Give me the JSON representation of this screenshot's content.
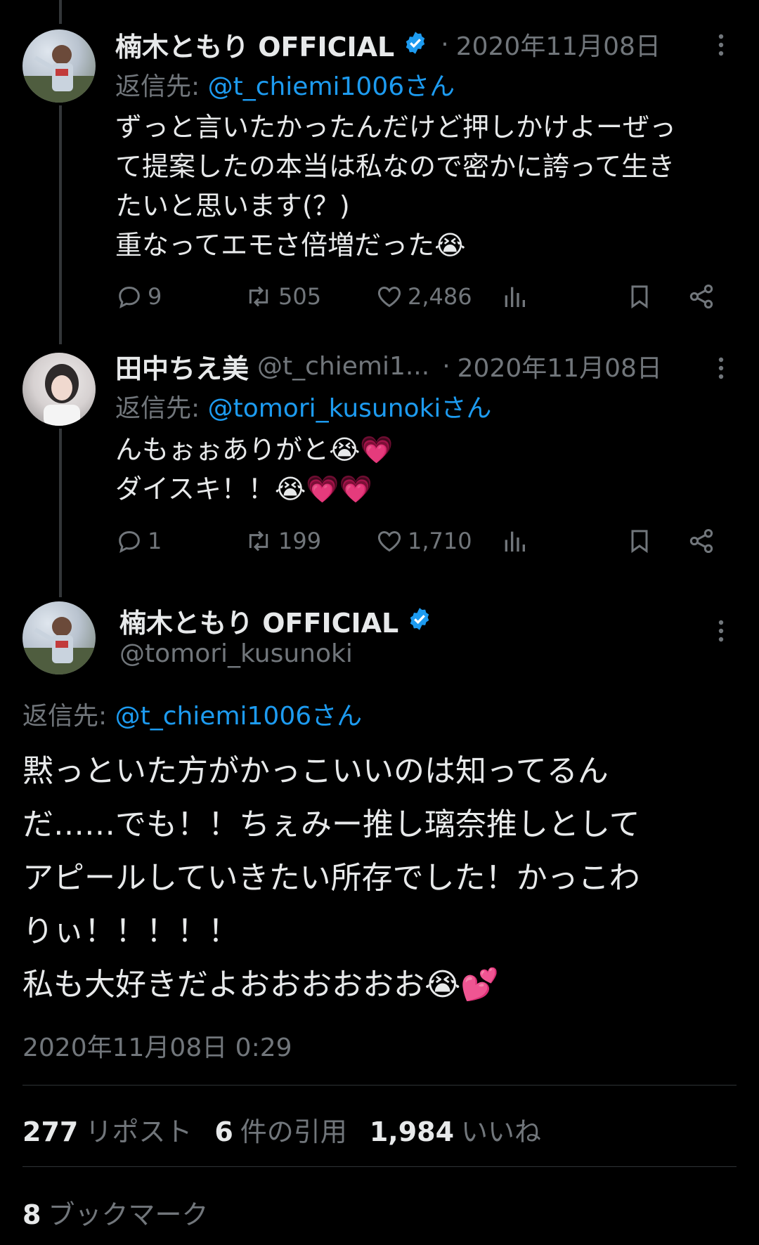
{
  "tweets": [
    {
      "display_name": "楠木ともり OFFICIAL",
      "verified": true,
      "timestamp": "2020年11月08日",
      "reply_prefix": "返信先: ",
      "reply_handle": "@t_chiemi1006さん",
      "text": "ずっと言いたかったんだけど押しかけよーぜっ\nて提案したの本当は私なので密かに誇って生き\nたいと思います(？)\n重なってエモさ倍増だった😭",
      "replies": "9",
      "reposts": "505",
      "likes": "2,486"
    },
    {
      "display_name": "田中ちえ美",
      "handle": "@t_chiemi1...",
      "timestamp": "2020年11月08日",
      "reply_prefix": "返信先: ",
      "reply_handle": "@tomori_kusunokiさん",
      "text": "んもぉぉありがと😭💗\nダイスキ！！😭💗💗",
      "replies": "1",
      "reposts": "199",
      "likes": "1,710"
    }
  ],
  "main_tweet": {
    "display_name": "楠木ともり OFFICIAL",
    "handle": "@tomori_kusunoki",
    "verified": true,
    "reply_prefix": "返信先: ",
    "reply_handle": "@t_chiemi1006さん",
    "text": "黙っといた方がかっこいいのは知ってるん\nだ……でも！！ちぇみー推し璃奈推しとして\nアピールしていきたい所存でした！かっこわ\nりぃ！！！！！\n私も大好きだよおおおおおお😭💕",
    "datetime": "2020年11月08日 0:29",
    "repost_count": "277",
    "repost_label": "リポスト",
    "quote_count": "6",
    "quote_label": "件の引用",
    "like_count": "1,984",
    "like_label": "いいね",
    "bookmark_count": "8",
    "bookmark_label": "ブックマーク"
  },
  "colors": {
    "accent": "#1d9bf0",
    "muted": "#71767b",
    "background": "#000000"
  },
  "icons": [
    "verified-badge-icon",
    "more-icon",
    "reply-icon",
    "repost-icon",
    "like-icon",
    "views-icon",
    "bookmark-icon",
    "share-icon"
  ]
}
